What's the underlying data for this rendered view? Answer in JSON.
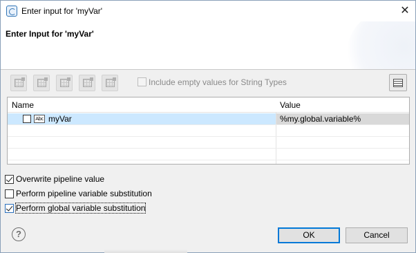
{
  "window": {
    "title": "Enter input for 'myVar'",
    "close_glyph": "✕"
  },
  "banner": {
    "title": "Enter Input for 'myVar'"
  },
  "toolbar": {
    "buttons": [
      {
        "icon": "add-row-icon",
        "enabled": false
      },
      {
        "icon": "insert-row-icon",
        "enabled": false
      },
      {
        "icon": "delete-row-icon",
        "enabled": false
      },
      {
        "icon": "delete-column-icon",
        "enabled": false
      },
      {
        "icon": "clear-table-icon",
        "enabled": false
      }
    ],
    "include_empty_label": "Include empty values for String Types",
    "include_empty_checked": false,
    "right_button_icon": "table-view-icon"
  },
  "table": {
    "headers": {
      "name": "Name",
      "value": "Value"
    },
    "rows": [
      {
        "name": "myVar",
        "type_icon": "Abc",
        "value": "%my.global.variable%",
        "checked": false,
        "selected": true
      }
    ]
  },
  "options": {
    "overwrite_label": "Overwrite pipeline value",
    "overwrite_checked": true,
    "pipeline_sub_label": "Perform pipeline variable substitution",
    "pipeline_sub_checked": false,
    "global_sub_label": "Perform global variable substitution",
    "global_sub_checked": true
  },
  "footer": {
    "help_glyph": "?",
    "ok_label": "OK",
    "cancel_label": "Cancel"
  }
}
